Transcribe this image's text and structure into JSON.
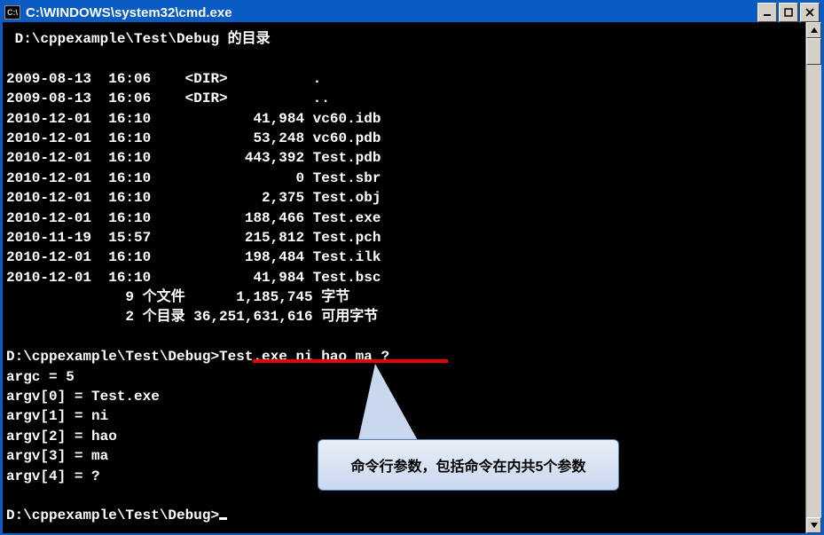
{
  "window": {
    "title": "C:\\WINDOWS\\system32\\cmd.exe",
    "icon_label": "C:\\"
  },
  "terminal": {
    "dir_header": " D:\\cppexample\\Test\\Debug 的目录",
    "entries": [
      {
        "date": "2009-08-13",
        "time": "16:06",
        "size": "<DIR>         ",
        "name": "."
      },
      {
        "date": "2009-08-13",
        "time": "16:06",
        "size": "<DIR>         ",
        "name": ".."
      },
      {
        "date": "2010-12-01",
        "time": "16:10",
        "size": "        41,984",
        "name": "vc60.idb"
      },
      {
        "date": "2010-12-01",
        "time": "16:10",
        "size": "        53,248",
        "name": "vc60.pdb"
      },
      {
        "date": "2010-12-01",
        "time": "16:10",
        "size": "       443,392",
        "name": "Test.pdb"
      },
      {
        "date": "2010-12-01",
        "time": "16:10",
        "size": "             0",
        "name": "Test.sbr"
      },
      {
        "date": "2010-12-01",
        "time": "16:10",
        "size": "         2,375",
        "name": "Test.obj"
      },
      {
        "date": "2010-12-01",
        "time": "16:10",
        "size": "       188,466",
        "name": "Test.exe"
      },
      {
        "date": "2010-11-19",
        "time": "15:57",
        "size": "       215,812",
        "name": "Test.pch"
      },
      {
        "date": "2010-12-01",
        "time": "16:10",
        "size": "       198,484",
        "name": "Test.ilk"
      },
      {
        "date": "2010-12-01",
        "time": "16:10",
        "size": "        41,984",
        "name": "Test.bsc"
      }
    ],
    "summary_files": "              9 个文件      1,185,745 字节",
    "summary_dirs": "              2 个目录 36,251,631,616 可用字节",
    "command_line": "D:\\cppexample\\Test\\Debug>Test.exe ni hao ma ?",
    "output": [
      "argc = 5",
      "argv[0] = Test.exe",
      "argv[1] = ni",
      "argv[2] = hao",
      "argv[3] = ma",
      "argv[4] = ?"
    ],
    "prompt": "D:\\cppexample\\Test\\Debug>"
  },
  "callout": {
    "text": "命令行参数，包括命令在内共5个参数"
  }
}
